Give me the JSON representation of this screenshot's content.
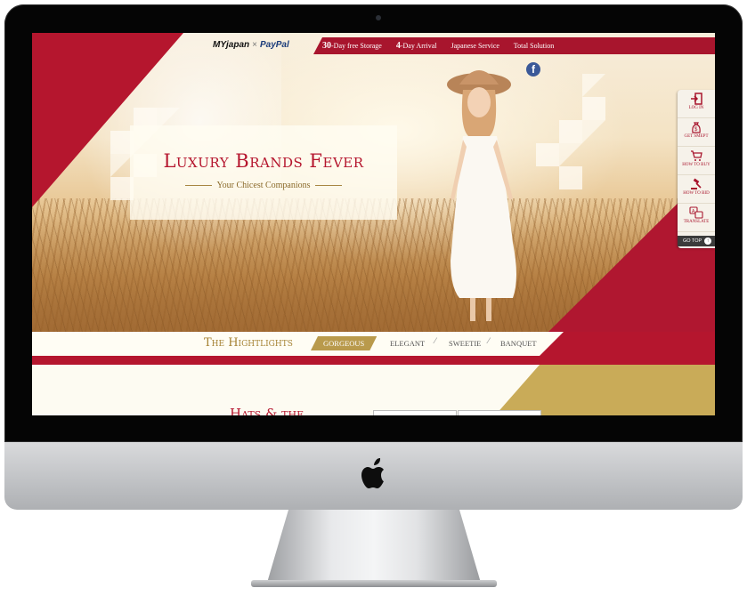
{
  "header": {
    "logo_myjapan": "MYjapan",
    "logo_cross": "×",
    "logo_paypal": "PayPal",
    "nav": [
      {
        "num": "30",
        "label": "-Day free Storage"
      },
      {
        "num": "4",
        "label": "-Day Arrival"
      },
      {
        "num": "",
        "label": "Japanese Service"
      },
      {
        "num": "",
        "label": "Total Solution"
      }
    ],
    "facebook_icon": "facebook-icon"
  },
  "hero": {
    "title": "Luxury Brands Fever",
    "subtitle": "Your Chicest Companions"
  },
  "side_menu": {
    "items": [
      {
        "icon": "login-icon",
        "label": "LOG IN"
      },
      {
        "icon": "money-bag-icon",
        "label": "GET SMEPT"
      },
      {
        "icon": "cart-icon",
        "label": "HOW TO BUY"
      },
      {
        "icon": "gavel-icon",
        "label": "HOW TO BID"
      },
      {
        "icon": "translate-icon",
        "label": "TRANSLATE"
      }
    ],
    "go_top": "GO TOP"
  },
  "highlights": {
    "title": "The Hightlights",
    "tabs": [
      "GORGEOUS",
      "ELEGANT",
      "SWEETIE",
      "BANQUET"
    ],
    "active_tab": "GORGEOUS"
  },
  "section": {
    "title_partial": "Hats & the"
  },
  "colors": {
    "brand_red": "#b5162e",
    "gold": "#c9ab58",
    "facebook": "#3b5998"
  }
}
